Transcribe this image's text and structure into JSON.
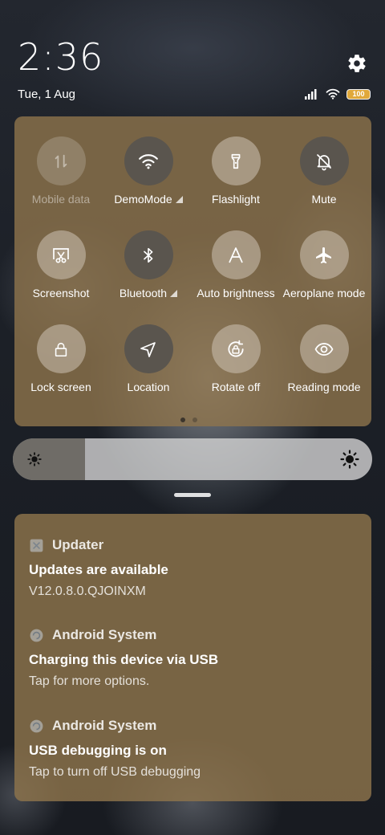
{
  "status": {
    "time": "2:36",
    "date": "Tue, 1 Aug",
    "battery": "100",
    "icons": [
      "settings-icon",
      "signal-icon",
      "wifi-icon",
      "battery-icon"
    ]
  },
  "quick_settings": {
    "tiles": [
      {
        "label": "Mobile data",
        "icon": "mobile-data-icon",
        "state": "disabled"
      },
      {
        "label": "DemoMode",
        "icon": "wifi-icon",
        "state": "on",
        "expand": true
      },
      {
        "label": "Flashlight",
        "icon": "flashlight-icon",
        "state": "off"
      },
      {
        "label": "Mute",
        "icon": "bell-off-icon",
        "state": "on"
      },
      {
        "label": "Screenshot",
        "icon": "screenshot-icon",
        "state": "off"
      },
      {
        "label": "Bluetooth",
        "icon": "bluetooth-icon",
        "state": "on",
        "expand": true
      },
      {
        "label": "Auto brightness",
        "icon": "auto-brightness-icon",
        "state": "off"
      },
      {
        "label": "Aeroplane mode",
        "icon": "airplane-icon",
        "state": "off"
      },
      {
        "label": "Lock screen",
        "icon": "lock-icon",
        "state": "off"
      },
      {
        "label": "Location",
        "icon": "location-icon",
        "state": "on"
      },
      {
        "label": "Rotate off",
        "icon": "rotate-lock-icon",
        "state": "off"
      },
      {
        "label": "Reading mode",
        "icon": "eye-icon",
        "state": "off"
      }
    ],
    "page_count": 2,
    "current_page": 1
  },
  "brightness": {
    "level": 0.2
  },
  "notifications": [
    {
      "app": "Updater",
      "icon": "updater-icon",
      "title": "Updates are available",
      "text": "V12.0.8.0.QJOINXM"
    },
    {
      "app": "Android System",
      "icon": "android-system-icon",
      "title": "Charging this device via USB",
      "text": "Tap for more options."
    },
    {
      "app": "Android System",
      "icon": "android-system-icon",
      "title": "USB debugging is on",
      "text": "Tap to turn off USB debugging"
    }
  ],
  "colors": {
    "panel": "#8e744c",
    "tile_on": "#5a554e",
    "battery": "#e0a83a"
  }
}
